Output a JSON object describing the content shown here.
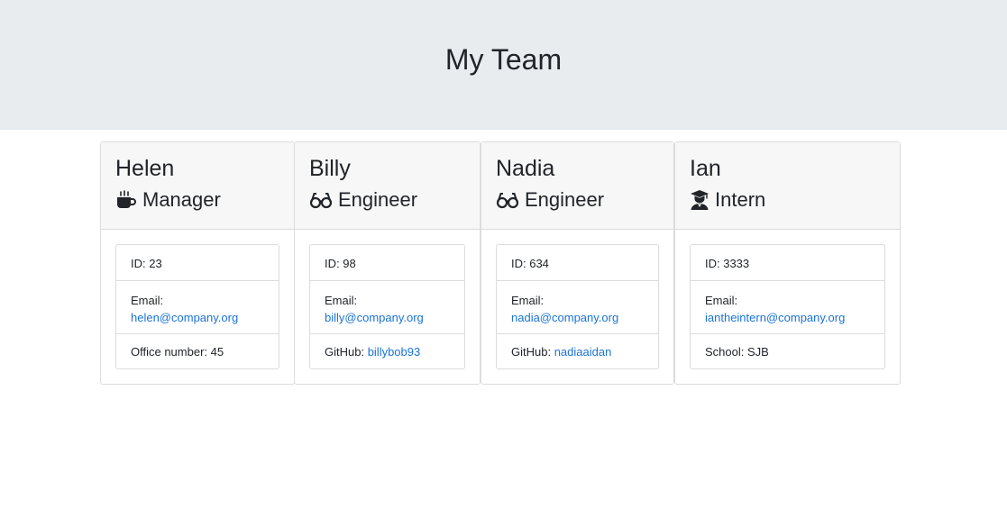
{
  "header": {
    "title": "My Team"
  },
  "team": [
    {
      "name": "Helen",
      "role": "Manager",
      "icon": "coffee-icon",
      "id_label": "ID: 23",
      "email_label": "Email:",
      "email": "helen@company.org",
      "extra_label": "Office number: 45",
      "extra_link": ""
    },
    {
      "name": "Billy",
      "role": "Engineer",
      "icon": "glasses-icon",
      "id_label": "ID: 98",
      "email_label": "Email:",
      "email": "billy@company.org",
      "extra_label": "GitHub: ",
      "extra_link": "billybob93"
    },
    {
      "name": "Nadia",
      "role": "Engineer",
      "icon": "glasses-icon",
      "id_label": "ID: 634",
      "email_label": "Email:",
      "email": "nadia@company.org",
      "extra_label": "GitHub: ",
      "extra_link": "nadiaaidan"
    },
    {
      "name": "Ian",
      "role": "Intern",
      "icon": "graduate-icon",
      "id_label": "ID: 3333",
      "email_label": "Email:",
      "email": "iantheintern@company.org",
      "extra_label": "School: SJB",
      "extra_link": ""
    }
  ]
}
